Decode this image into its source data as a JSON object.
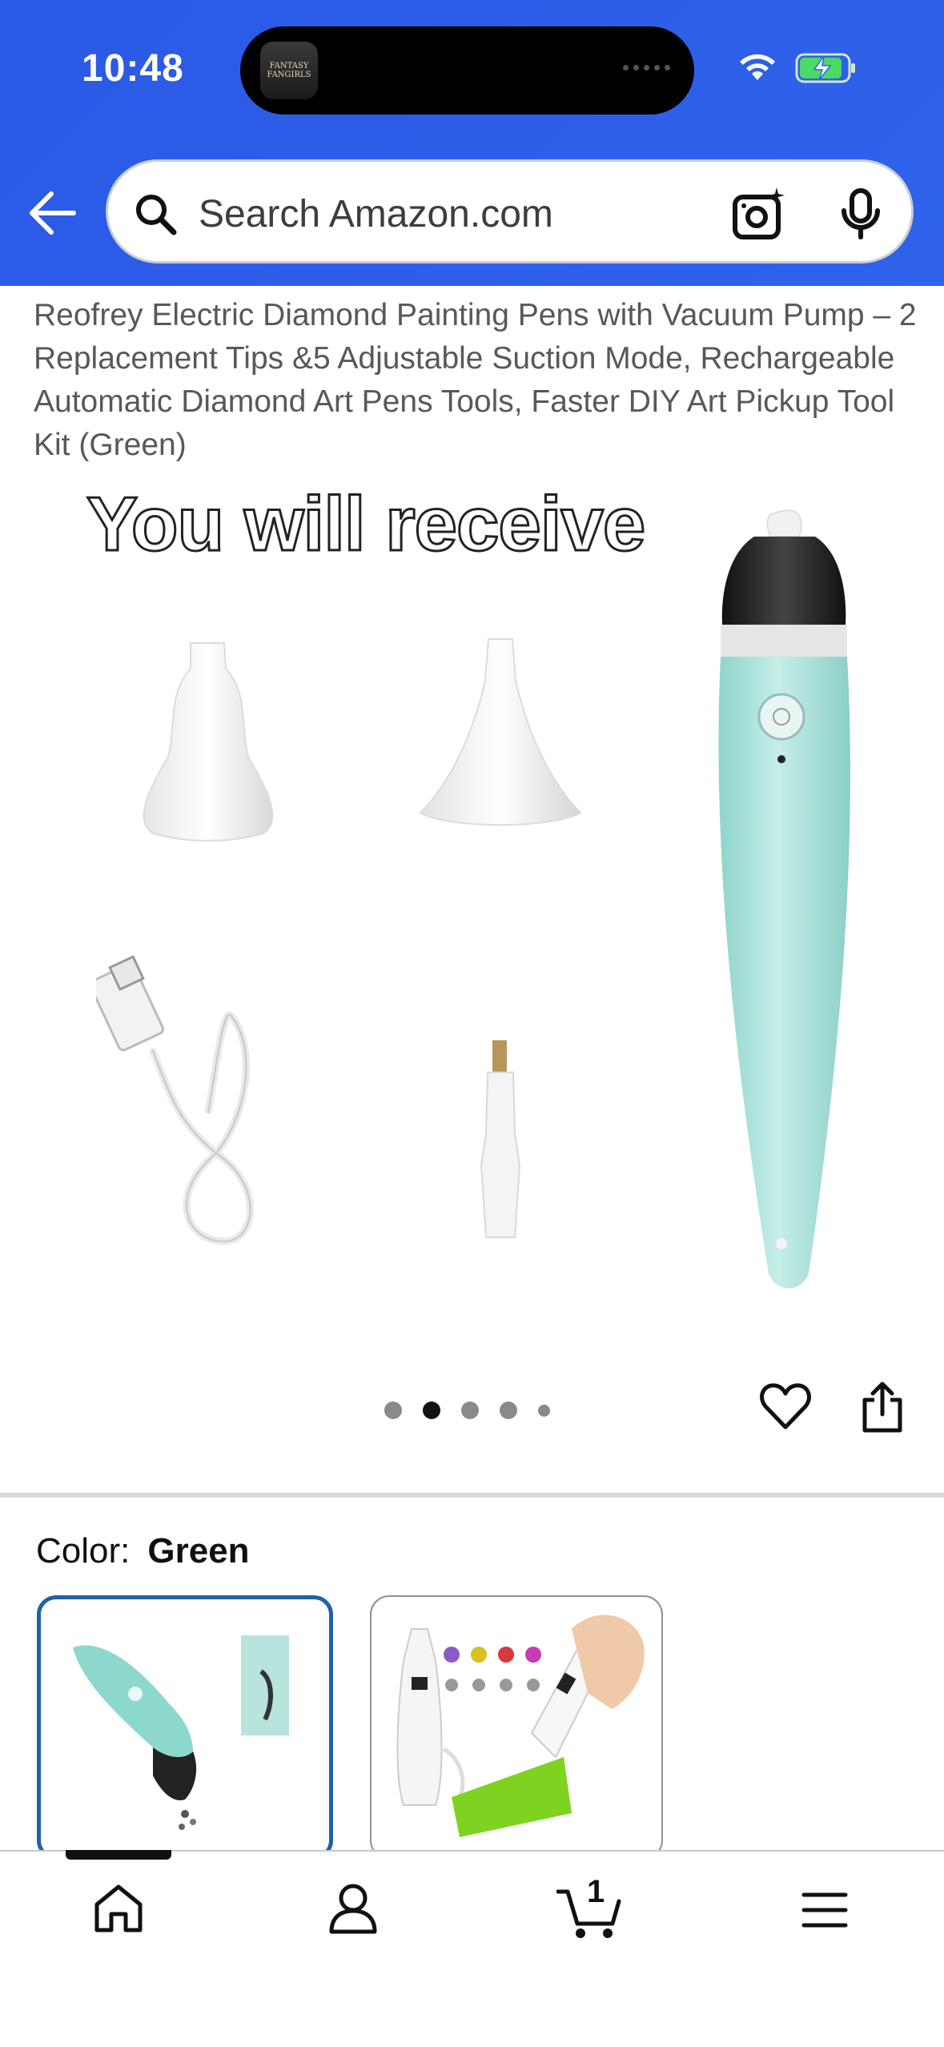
{
  "status_bar": {
    "time": "10:48",
    "island_app_label": "FANTASY FANGIRLS"
  },
  "header": {
    "search_placeholder": "Search Amazon.com"
  },
  "product": {
    "title": "Reofrey Electric Diamond Painting Pens with Vacuum Pump – 2 Replacement Tips &5 Adjustable Suction Mode, Rechargeable Automatic Diamond Art Pens Tools, Faster DIY Art Pickup Tool Kit (Green)",
    "image_caption": "You will receive",
    "image_count": 5,
    "active_image": 2
  },
  "color": {
    "label": "Color:",
    "value": "Green",
    "options": [
      "Green",
      "White"
    ]
  },
  "bottom_nav": {
    "cart_count": "1",
    "items": [
      "home-icon",
      "account-icon",
      "cart-icon",
      "menu-icon"
    ]
  },
  "colors": {
    "header_blue": "#2f63ea",
    "swatch_selected": "#2162a1",
    "pen_teal": "#a9e3dc"
  }
}
